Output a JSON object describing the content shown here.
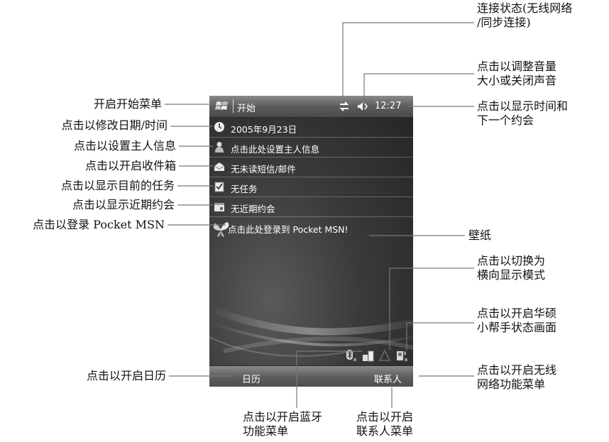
{
  "screen": {
    "title_bar": {
      "start_label": "开始",
      "time": "12:27"
    },
    "today_items": [
      {
        "icon": "clock-icon",
        "text": "2005年9月23日"
      },
      {
        "icon": "owner-icon",
        "text": "点击此处设置主人信息"
      },
      {
        "icon": "inbox-icon",
        "text": "无未读短信/邮件"
      },
      {
        "icon": "tasks-icon",
        "text": "无任务"
      },
      {
        "icon": "calendar-icon",
        "text": "无近期约会"
      }
    ],
    "msn_item": {
      "icon": "msn-butterfly-icon",
      "text": "点击此处登录到 Pocket MSN!"
    },
    "softkeys": {
      "left": "日历",
      "right": "联系人"
    }
  },
  "annotations": {
    "left": [
      "开启开始菜单",
      "点击以修改日期/时间",
      "点击以设置主人信息",
      "点击以开启收件箱",
      "点击以显示目前的任务",
      "点击以显示近期约会",
      "点击以登录 Pocket MSN",
      "点击以开启日历"
    ],
    "right": {
      "connection": [
        "连接状态(无线网络",
        "/同步连接)"
      ],
      "volume": [
        "点击以调整音量",
        "大小或关闭声音"
      ],
      "clock": [
        "点击以显示时间和",
        "下一个约会"
      ],
      "wallpaper": "壁纸",
      "rotate": [
        "点击以切换为",
        "横向显示模式"
      ],
      "asus": [
        "点击以开启华硕",
        "小帮手状态画面"
      ],
      "wireless": [
        "点击以开启无线",
        "网络功能菜单"
      ]
    },
    "bottom": {
      "bluetooth": [
        "点击以开启蓝牙",
        "功能菜单"
      ],
      "contacts": [
        "点击以开启",
        "联系人菜单"
      ]
    }
  }
}
